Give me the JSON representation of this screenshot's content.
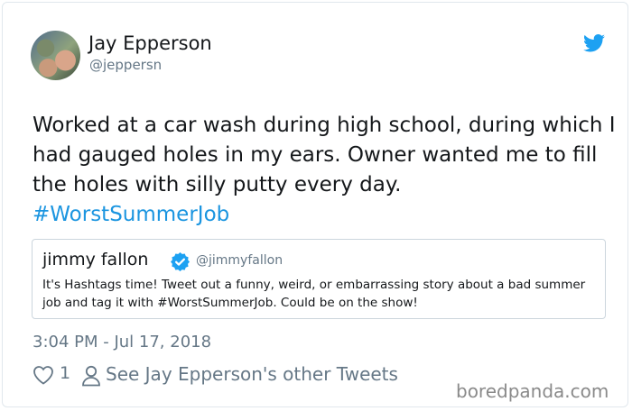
{
  "tweet": {
    "author": {
      "display_name": "Jay Epperson",
      "handle": "@jeppersn"
    },
    "text_main": "Worked at a car wash during high school, during which I had gauged holes in my ears. Owner wanted me to fill the holes with silly putty every day.",
    "hashtag": "#WorstSummerJob",
    "quoted": {
      "display_name": "jimmy fallon",
      "handle": "@jimmyfallon",
      "text": "It's Hashtags time! Tweet out a funny, weird, or embarrassing story about a bad summer job and tag it with #WorstSummerJob. Could be on the show!"
    },
    "timestamp": "3:04 PM - Jul 17, 2018",
    "like_count": "1",
    "other_tweets_label": "See Jay Epperson's other Tweets"
  },
  "watermark": "boredpanda.com",
  "icons": {
    "brand": "twitter-bird-icon",
    "verified": "verified-badge-icon",
    "like": "heart-icon",
    "profile": "person-icon"
  },
  "colors": {
    "link": "#1b95e0",
    "secondary": "#657786",
    "border": "#e1e8ed"
  }
}
